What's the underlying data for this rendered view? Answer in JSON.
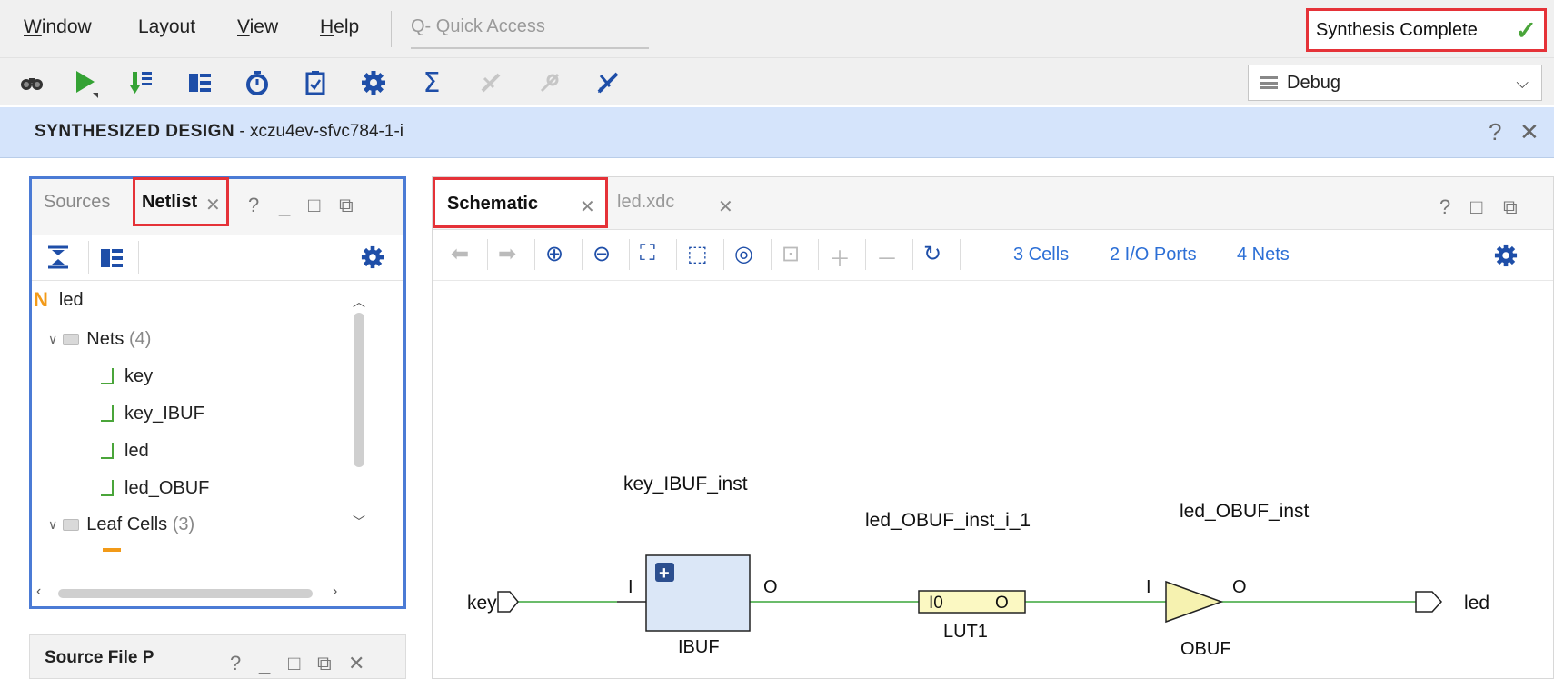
{
  "menu": {
    "items": [
      {
        "label": "Window",
        "mnemonic": "W",
        "rest": "indow"
      },
      {
        "label": "Layout",
        "mnemonic": "",
        "rest": "Layout"
      },
      {
        "label": "View",
        "mnemonic": "V",
        "rest": "iew"
      },
      {
        "label": "Help",
        "mnemonic": "H",
        "rest": "elp"
      }
    ],
    "quick_access_placeholder": "Q- Quick Access"
  },
  "status": {
    "text": "Synthesis Complete",
    "icon": "check-icon",
    "color": "#4aa53a"
  },
  "toolbar": {
    "icons": [
      "binoculars-icon",
      "run-icon",
      "step-icon",
      "synth-icon",
      "timer-icon",
      "clipboard-icon",
      "settings-icon",
      "sigma-icon",
      "disabled-tool-icon",
      "disabled-attach-icon",
      "cross-tool-icon"
    ],
    "layout_select": "Debug"
  },
  "design_header": {
    "title": "SYNTHESIZED DESIGN",
    "part": " - xczu4ev-sfvc784-1-i",
    "help": "?",
    "close": "✕"
  },
  "left_panel": {
    "tabs": [
      "Sources",
      "Netlist"
    ],
    "active_tab": "Netlist",
    "controls": [
      "?",
      "_",
      "□",
      "⧉"
    ],
    "tree": {
      "root": "led",
      "nets_label": "Nets",
      "nets_count": "(4)",
      "nets": [
        "key",
        "key_IBUF",
        "led",
        "led_OBUF"
      ],
      "leaf_label": "Leaf Cells",
      "leaf_count": "(3)"
    }
  },
  "source_panel": {
    "title": "Source File P",
    "controls": [
      "?",
      "_",
      "□",
      "⧉",
      "✕"
    ]
  },
  "schematic": {
    "tabs": [
      "Schematic",
      "led.xdc"
    ],
    "active_tab": "Schematic",
    "stats": {
      "cells": "3 Cells",
      "ports": "2 I/O Ports",
      "nets": "4 Nets"
    },
    "ports": {
      "in": "key",
      "out": "led"
    },
    "cells": {
      "ibuf": {
        "name": "key_IBUF_inst",
        "type": "IBUF",
        "pin_in": "I",
        "pin_out": "O"
      },
      "lut": {
        "name": "led_OBUF_inst_i_1",
        "type": "LUT1",
        "pin_in": "I0",
        "pin_out": "O"
      },
      "obuf": {
        "name": "led_OBUF_inst",
        "type": "OBUF",
        "pin_in": "I",
        "pin_out": "O"
      }
    },
    "colors": {
      "wire": "#3aa53a",
      "ibuf_fill": "#dbe7f7",
      "lut_fill": "#fbf8c2",
      "obuf_fill": "#f6f2b0",
      "link": "#2c6fd6",
      "highlight": "#e53238"
    }
  }
}
